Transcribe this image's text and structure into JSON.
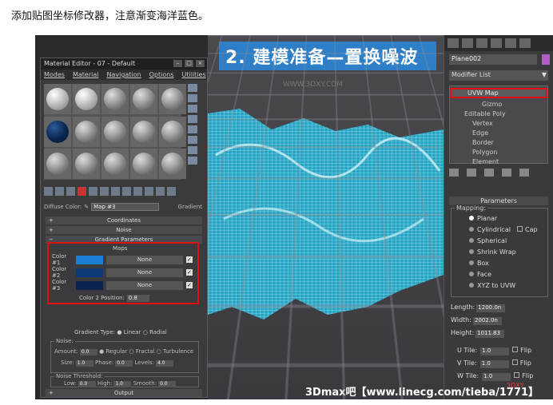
{
  "caption": "添加贴图坐标修改器，注意渐变海洋蓝色。",
  "banner": "2. 建模准备—置换噪波",
  "watermark_top": "WWW.3DXY.COM",
  "watermark_bottom": "3Dmax吧【www.linecg.com/tieba/1771】",
  "material_editor": {
    "title": "Material Editor - 07 - Default",
    "menu": [
      "Modes",
      "Material",
      "Navigation",
      "Options",
      "Utilities"
    ],
    "diffuse_label": "Diffuse Color:",
    "map_value": "Map #3",
    "map_type": "Gradient",
    "rollouts": {
      "coordinates": "Coordinates",
      "noise": "Noise",
      "gradient_params": "Gradient Parameters",
      "output": "Output"
    },
    "maps_label": "Maps",
    "colors": [
      {
        "label": "Color #1",
        "swatch": "#1a7ed4",
        "map": "None"
      },
      {
        "label": "Color #2",
        "swatch": "#0c3a78",
        "map": "None"
      },
      {
        "label": "Color #3",
        "swatch": "#0a2250",
        "map": "None"
      }
    ],
    "color2_position_label": "Color 2 Position:",
    "color2_position": "0.8",
    "gradient_type_label": "Gradient Type:",
    "gradient_types": [
      "Linear",
      "Radial"
    ],
    "noise": {
      "title": "Noise:",
      "amount_label": "Amount:",
      "amount": "0.0",
      "types": [
        "Regular",
        "Fractal",
        "Turbulence"
      ],
      "size_label": "Size:",
      "size": "1.0",
      "phase_label": "Phase:",
      "phase": "0.0",
      "levels_label": "Levels:",
      "levels": "4.0"
    },
    "threshold": {
      "title": "Noise Threshold:",
      "low_label": "Low:",
      "low": "0.0",
      "high_label": "High:",
      "high": "1.0",
      "smooth_label": "Smooth:",
      "smooth": "0.0"
    }
  },
  "modifier_panel": {
    "object_name": "Plane002",
    "object_color": "#b45cc8",
    "modifier_list": "Modifier List",
    "stack": {
      "uvw": "UVW Map",
      "gizmo": "Gizmo",
      "poly": "Editable Poly",
      "subs": [
        "Vertex",
        "Edge",
        "Border",
        "Polygon",
        "Element"
      ]
    },
    "params_title": "Parameters",
    "mapping_title": "Mapping:",
    "mapping_options": [
      "Planar",
      "Cylindrical",
      "Spherical",
      "Shrink Wrap",
      "Box",
      "Face",
      "XYZ to UVW"
    ],
    "cap": "Cap",
    "length_label": "Length:",
    "length": "1200.0n",
    "width_label": "Width:",
    "width": "2002.0n",
    "height_label": "Height:",
    "height": "1011.83",
    "u_tile_label": "U Tile:",
    "u_tile": "1.0",
    "v_tile_label": "V Tile:",
    "v_tile": "1.0",
    "w_tile_label": "W Tile:",
    "w_tile": "1.0",
    "flip": "Flip"
  },
  "watermark_right": "3DXY"
}
